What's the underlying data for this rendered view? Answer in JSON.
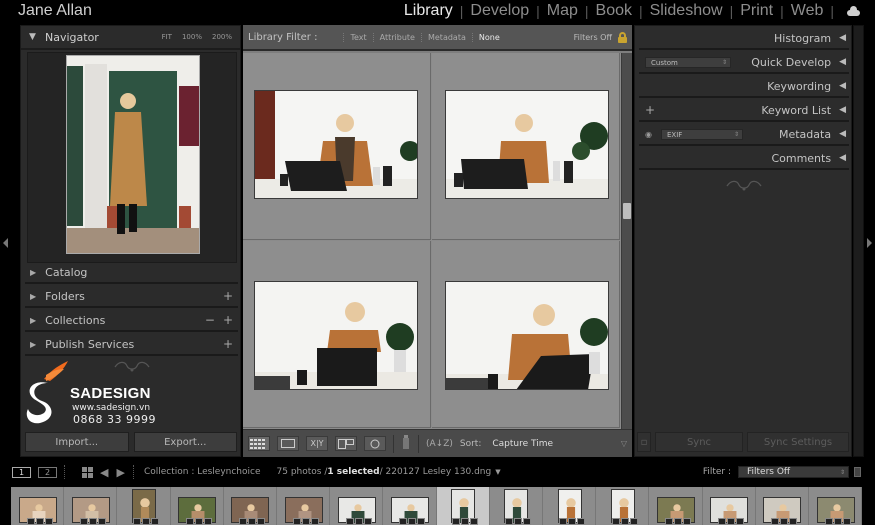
{
  "identity_plate": "Jane Allan",
  "modules": [
    {
      "label": "Library",
      "active": true
    },
    {
      "label": "Develop",
      "active": false
    },
    {
      "label": "Map",
      "active": false
    },
    {
      "label": "Book",
      "active": false
    },
    {
      "label": "Slideshow",
      "active": false
    },
    {
      "label": "Print",
      "active": false
    },
    {
      "label": "Web",
      "active": false
    }
  ],
  "cloud_icon": "cloud-icon",
  "left_panel": {
    "navigator": {
      "title": "Navigator",
      "zoom_options": [
        "FIT",
        "100%",
        "200%"
      ]
    },
    "sections": [
      {
        "label": "Catalog",
        "actions": []
      },
      {
        "label": "Folders",
        "actions": [
          "+"
        ]
      },
      {
        "label": "Collections",
        "actions": [
          "−",
          "+"
        ]
      },
      {
        "label": "Publish Services",
        "actions": [
          "+"
        ]
      }
    ],
    "watermark": {
      "brand": "SADESIGN",
      "website": "www.sadesign.vn",
      "phone": "0868 33 9999"
    },
    "import_label": "Import...",
    "export_label": "Export..."
  },
  "filter_bar": {
    "label": "Library Filter :",
    "options": [
      {
        "label": "Text",
        "active": false
      },
      {
        "label": "Attribute",
        "active": false
      },
      {
        "label": "Metadata",
        "active": false
      },
      {
        "label": "None",
        "active": true
      }
    ],
    "status": "Filters Off",
    "lock_color": "#c9a430"
  },
  "grid": {
    "photos": [
      {
        "desc": "Woman with leopard scarf typing on laptop"
      },
      {
        "desc": "Woman resting chin on hand at desk"
      },
      {
        "desc": "Woman with chin on hand behind laptop"
      },
      {
        "desc": "Woman smiling leaning on desk with laptop"
      }
    ]
  },
  "toolbar": {
    "view_modes": [
      "grid-view",
      "loupe-view",
      "compare-view",
      "survey-view",
      "people-view"
    ],
    "sort_label": "Sort:",
    "sort_value": "Capture Time"
  },
  "right_panel": {
    "sections": [
      {
        "label": "Histogram"
      },
      {
        "label": "Quick Develop",
        "preset": "Custom"
      },
      {
        "label": "Keywording"
      },
      {
        "label": "Keyword List",
        "prefix": "+"
      },
      {
        "label": "Metadata",
        "preset": "EXIF"
      },
      {
        "label": "Comments"
      }
    ],
    "sync_label": "Sync",
    "sync_settings_label": "Sync Settings"
  },
  "filmstrip_header": {
    "monitors": [
      "1",
      "2"
    ],
    "source": "Collection : Lesleynchoice",
    "count": "75 photos /",
    "selected": "1 selected",
    "filename": "/ 220127 Lesley 130.dng",
    "filter_label": "Filter :",
    "filter_value": "Filters Off"
  },
  "filmstrip": {
    "frame_count": 16,
    "selected_index": 8
  }
}
